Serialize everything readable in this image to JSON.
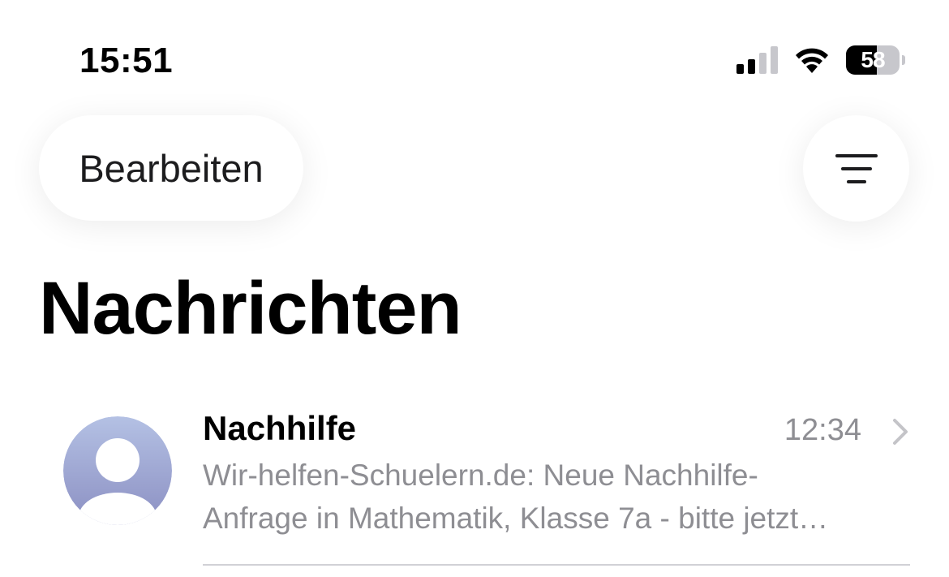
{
  "status_bar": {
    "time": "15:51",
    "battery_percent": "58",
    "battery_level": 0.58,
    "signal_bars_active": 2,
    "signal_bars_total": 4,
    "icons": [
      "cellular-signal-icon",
      "wifi-icon",
      "battery-icon"
    ]
  },
  "toolbar": {
    "edit_label": "Bearbeiten",
    "filter_icon": "filter-lines-icon"
  },
  "page": {
    "title": "Nachrichten"
  },
  "messages": [
    {
      "sender": "Nachhilfe",
      "time": "12:34",
      "preview_line_1": "Wir-helfen-Schuelern.de: Neue Nachhilfe-",
      "preview_line_2": "Anfrage in Mathematik, Klasse 7a - bitte jetzt…",
      "avatar_icon": "person-icon",
      "chevron_icon": "chevron-right-icon"
    }
  ],
  "colors": {
    "secondary_text": "#8e8e93",
    "avatar_gradient_top": "#b4c1e4",
    "avatar_gradient_bottom": "#8b8fc2",
    "separator": "#d1d1d6"
  }
}
